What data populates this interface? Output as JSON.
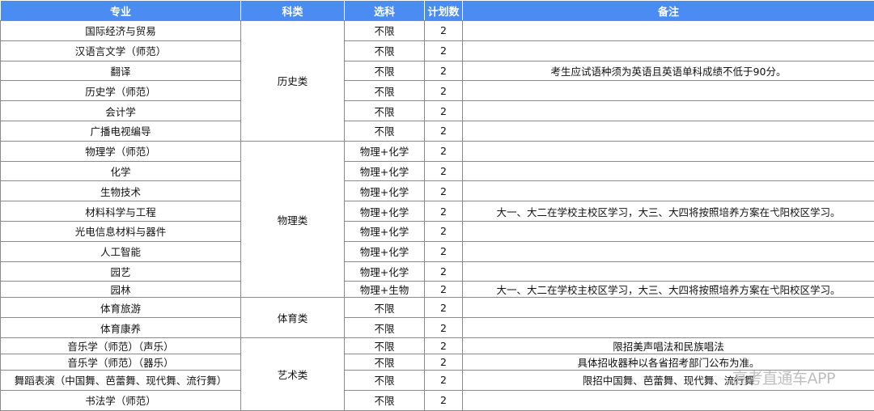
{
  "headers": {
    "major": "专业",
    "category": "科类",
    "subject": "选科",
    "quota": "计划数",
    "remark": "备注"
  },
  "groups": {
    "history": "历史类",
    "physics": "物理类",
    "sports": "体育类",
    "arts": "艺术类"
  },
  "rows": [
    {
      "major": "国际经济与贸易",
      "subject": "不限",
      "quota": "2"
    },
    {
      "major": "汉语言文学（师范）",
      "subject": "不限",
      "quota": "2"
    },
    {
      "major": "翻译",
      "subject": "不限",
      "quota": "2",
      "remark": "考生应试语种须为英语且英语单科成绩不低于90分。"
    },
    {
      "major": "历史学（师范）",
      "subject": "不限",
      "quota": "2"
    },
    {
      "major": "会计学",
      "subject": "不限",
      "quota": "2"
    },
    {
      "major": "广播电视编导",
      "subject": "不限",
      "quota": "2"
    },
    {
      "major": "物理学（师范）",
      "subject": "物理+化学",
      "quota": "2"
    },
    {
      "major": "化学",
      "subject": "物理+化学",
      "quota": "2"
    },
    {
      "major": "生物技术",
      "subject": "物理+化学",
      "quota": "2"
    },
    {
      "major": "材料科学与工程",
      "subject": "物理+化学",
      "quota": "2",
      "remark": "大一、大二在学校主校区学习，大三、大四将按照培养方案在弋阳校区学习。"
    },
    {
      "major": "光电信息材料与器件",
      "subject": "物理+化学",
      "quota": "2"
    },
    {
      "major": "人工智能",
      "subject": "物理+化学",
      "quota": "2"
    },
    {
      "major": "园艺",
      "subject": "物理+化学",
      "quota": "2"
    },
    {
      "major": "园林",
      "subject": "物理+生物",
      "quota": "2",
      "remark": "大一、大二在学校主校区学习，大三、大四将按照培养方案在弋阳校区学习。"
    },
    {
      "major": "体育旅游",
      "subject": "不限",
      "quota": "2"
    },
    {
      "major": "体育康养",
      "subject": "不限",
      "quota": "2"
    },
    {
      "major": "音乐学（师范）（声乐）",
      "subject": "不限",
      "quota": "2",
      "remark": "限招美声唱法和民族唱法"
    },
    {
      "major": "音乐学（师范）（器乐）",
      "subject": "不限",
      "quota": "2",
      "remark": "具体招收器种以各省招考部门公布为准。"
    },
    {
      "major": "舞蹈表演（中国舞、芭蕾舞、现代舞、流行舞）",
      "subject": "不限",
      "quota": "2",
      "remark": "限招中国舞、芭蕾舞、现代舞、流行舞"
    },
    {
      "major": "书法学（师范）",
      "subject": "不限",
      "quota": "2"
    }
  ],
  "watermark": "高考直通车APP"
}
